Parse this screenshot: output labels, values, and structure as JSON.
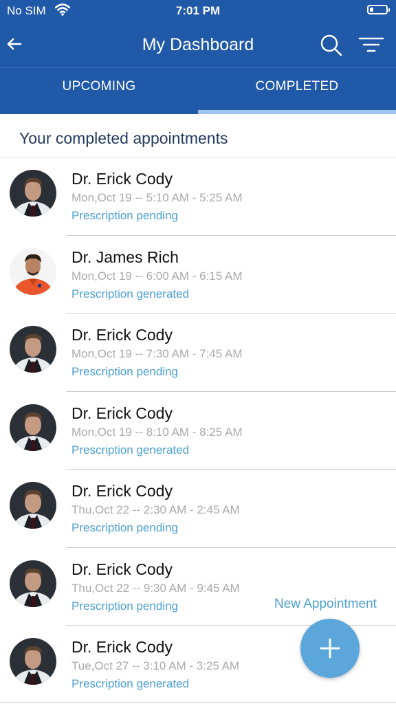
{
  "status_bar": {
    "carrier": "No SIM",
    "time": "7:01 PM",
    "wifi_icon": "wifi-icon",
    "battery_icon": "battery-icon"
  },
  "app_bar": {
    "title": "My Dashboard",
    "back_icon": "arrow-left-icon",
    "search_icon": "search-icon",
    "filter_icon": "filter-icon"
  },
  "tabs": [
    {
      "label": "UPCOMING",
      "selected": false
    },
    {
      "label": "COMPLETED",
      "selected": true
    }
  ],
  "section_title": "Your completed appointments",
  "appointments": [
    {
      "doctor": "Dr. Erick Cody",
      "time": "Mon,Oct 19 -- 5:10 AM - 5:25 AM",
      "status": "Prescription pending",
      "avatar": "erick"
    },
    {
      "doctor": "Dr. James Rich",
      "time": "Mon,Oct 19 -- 6:00 AM - 6:15 AM",
      "status": "Prescription generated",
      "avatar": "james"
    },
    {
      "doctor": "Dr. Erick Cody",
      "time": "Mon,Oct 19 -- 7:30 AM - 7:45 AM",
      "status": "Prescription pending",
      "avatar": "erick"
    },
    {
      "doctor": "Dr. Erick Cody",
      "time": "Mon,Oct 19 -- 8:10 AM - 8:25 AM",
      "status": "Prescription generated",
      "avatar": "erick"
    },
    {
      "doctor": "Dr. Erick Cody",
      "time": "Thu,Oct 22 -- 2:30 AM - 2:45 AM",
      "status": "Prescription pending",
      "avatar": "erick"
    },
    {
      "doctor": "Dr. Erick Cody",
      "time": "Thu,Oct 22 -- 9:30 AM - 9:45 AM",
      "status": "Prescription pending",
      "avatar": "erick"
    },
    {
      "doctor": "Dr. Erick Cody",
      "time": "Tue,Oct 27 -- 3:10 AM - 3:25 AM",
      "status": "Prescription generated",
      "avatar": "erick"
    }
  ],
  "fab": {
    "label": "New Appointment",
    "icon": "plus-icon"
  },
  "colors": {
    "primary": "#2159a9",
    "accent": "#5ba6da",
    "status_text": "#4c9fd3",
    "tab_indicator": "#9cc4ec"
  }
}
